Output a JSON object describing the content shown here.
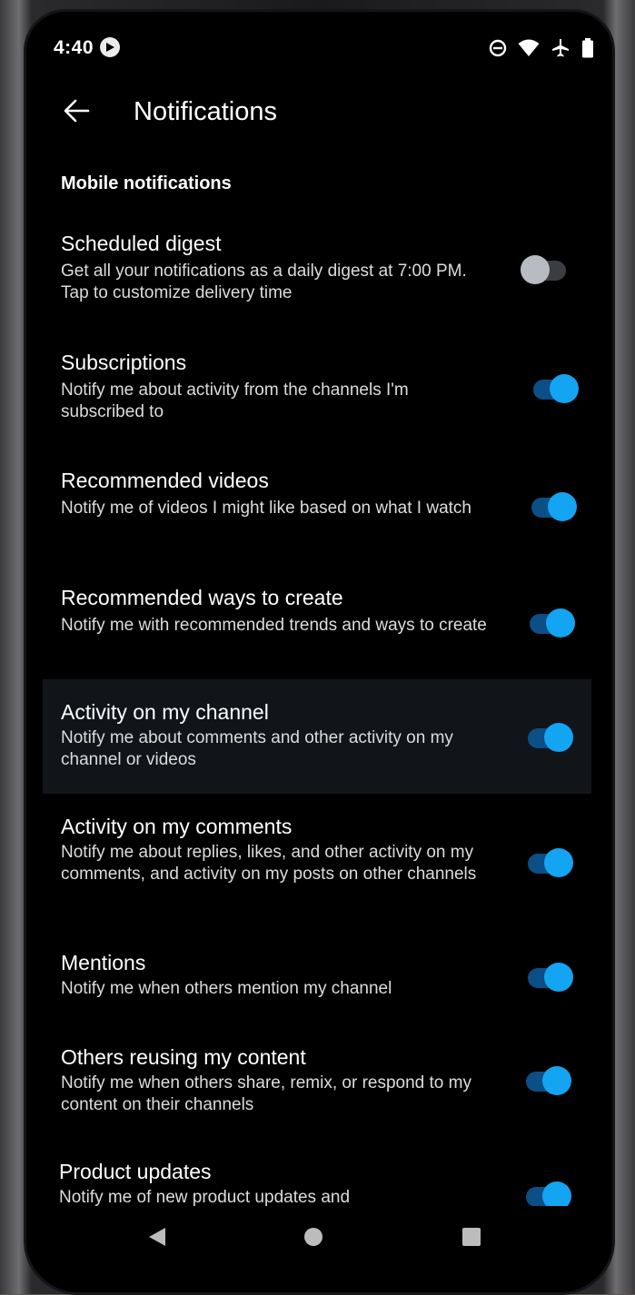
{
  "status_bar": {
    "time": "4:40",
    "icons": [
      "media-icon",
      "do-not-disturb-icon",
      "wifi-icon",
      "airplane-icon",
      "battery-icon"
    ]
  },
  "app_bar": {
    "title": "Notifications",
    "back_icon": "arrow-back-icon"
  },
  "section": {
    "title": "Mobile notifications"
  },
  "settings": [
    {
      "title": "Scheduled digest",
      "description": "Get all your notifications as a daily digest at 7:00 PM. Tap to customize delivery time",
      "enabled": false
    },
    {
      "title": "Subscriptions",
      "description": "Notify me about activity from the channels I'm subscribed to",
      "enabled": true
    },
    {
      "title": "Recommended videos",
      "description": "Notify me of videos I might like based on what I watch",
      "enabled": true
    },
    {
      "title": "Recommended ways to create",
      "description": "Notify me with recommended trends and ways to create",
      "enabled": true
    },
    {
      "title": "Activity on my channel",
      "description": "Notify me about comments and other activity on my channel or videos",
      "enabled": true
    },
    {
      "title": "Activity on my comments",
      "description": "Notify me about replies, likes, and other activity on my comments, and activity on my posts on other channels",
      "enabled": true
    },
    {
      "title": "Mentions",
      "description": "Notify me when others mention my channel",
      "enabled": true
    },
    {
      "title": "Others reusing my content",
      "description": "Notify me when others share, remix, or respond to my content on their channels",
      "enabled": true
    },
    {
      "title": "Product updates",
      "description": "Notify me of new product updates and",
      "enabled": true
    }
  ],
  "nav_bar": {
    "back": "back-triangle-icon",
    "home": "home-circle-icon",
    "recents": "recents-square-icon"
  },
  "colors": {
    "background": "#000000",
    "toggle_on_knob": "#13a4f2",
    "toggle_on_track": "#0c4e86",
    "toggle_off_knob": "#b8bcc2",
    "highlight_row": "#111419"
  }
}
